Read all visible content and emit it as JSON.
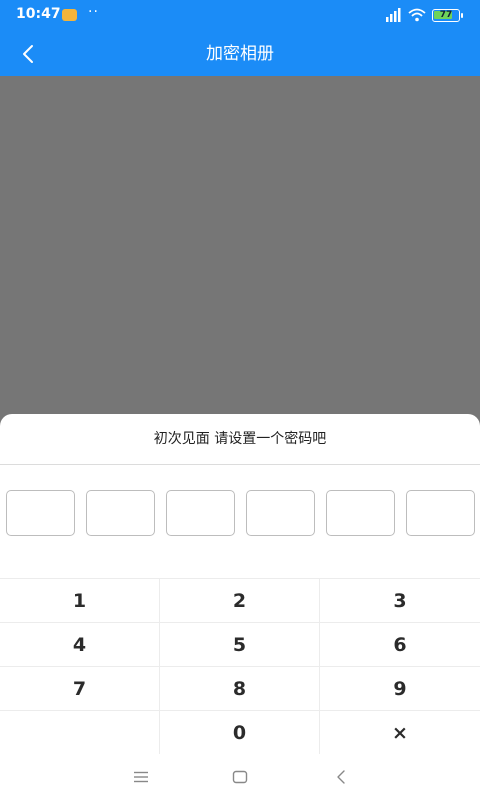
{
  "status_bar": {
    "time": "10:47",
    "dots": "··",
    "battery_level": "77",
    "battery_percent": 77
  },
  "app_bar": {
    "title": "加密相册",
    "back_icon": "chevron-left-icon"
  },
  "sheet": {
    "title": "初次见面 请设置一个密码吧",
    "pin_length": 6
  },
  "keypad": {
    "keys": [
      "1",
      "2",
      "3",
      "4",
      "5",
      "6",
      "7",
      "8",
      "9",
      "",
      "0",
      "×"
    ]
  },
  "nav_bar": {
    "icons": [
      "menu-icon",
      "home-icon",
      "back-icon"
    ]
  },
  "colors": {
    "accent": "#1b8cf7",
    "overlay": "#767676",
    "battery": "#6ed35a"
  }
}
